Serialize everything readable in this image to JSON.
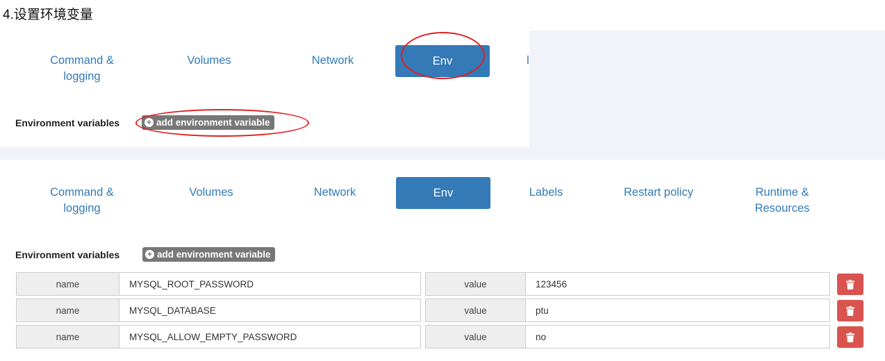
{
  "heading": "4.设置环境变量",
  "top_panel": {
    "tabs": [
      "Command &",
      "logging",
      "Volumes",
      "Network",
      "Env",
      "l"
    ],
    "env_label": "Environment variables",
    "add_button": "add environment variable"
  },
  "bottom_panel": {
    "tabs": {
      "command_line1": "Command &",
      "command_line2": "logging",
      "volumes": "Volumes",
      "network": "Network",
      "env": "Env",
      "labels": "Labels",
      "restart": "Restart policy",
      "runtime_line1": "Runtime &",
      "runtime_line2": "Resources"
    },
    "env_label": "Environment variables",
    "add_button": "add environment variable",
    "name_addon": "name",
    "value_addon": "value",
    "rows": [
      {
        "name": "MYSQL_ROOT_PASSWORD",
        "value": "123456"
      },
      {
        "name": "MYSQL_DATABASE",
        "value": "ptu"
      },
      {
        "name": "MYSQL_ALLOW_EMPTY_PASSWORD",
        "value": "no"
      }
    ]
  },
  "colors": {
    "accent": "#337ab7",
    "danger": "#d9534f",
    "annotation": "#e02020",
    "button_gray": "#777777"
  }
}
